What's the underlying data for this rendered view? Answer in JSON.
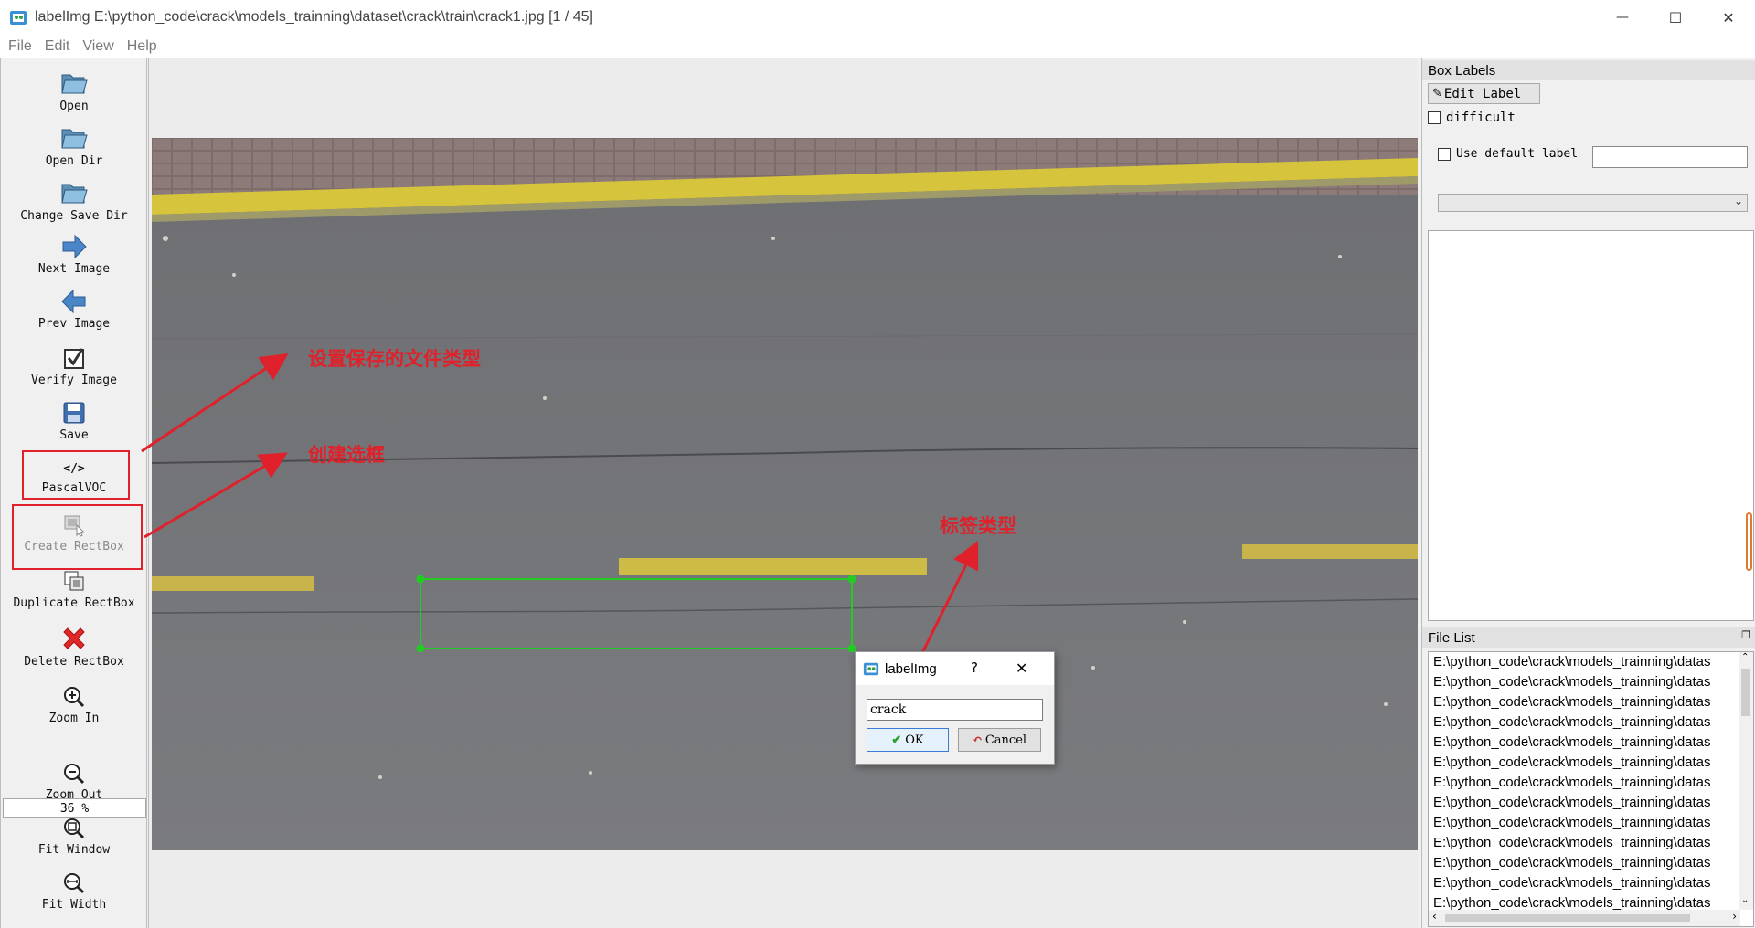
{
  "window": {
    "title": "labelImg E:\\python_code\\crack\\models_trainning\\dataset\\crack\\train\\crack1.jpg [1 / 45]",
    "minimize_symbol": "—",
    "maximize_symbol": "☐",
    "close_symbol": "✕"
  },
  "menu": [
    "File",
    "Edit",
    "View",
    "Help"
  ],
  "toolbar": {
    "open": "Open",
    "open_dir": "Open Dir",
    "change_save_dir": "Change Save Dir",
    "next_image": "Next Image",
    "prev_image": "Prev Image",
    "verify_image": "Verify Image",
    "save": "Save",
    "save_format": "PascalVOC",
    "create_rectbox": "Create RectBox",
    "duplicate_rectbox": "Duplicate RectBox",
    "delete_rectbox": "Delete RectBox",
    "zoom_in": "Zoom In",
    "zoom_value": "36 %",
    "zoom_out": "Zoom Out",
    "fit_window": "Fit Window",
    "fit_width": "Fit Width"
  },
  "annotations": {
    "save_format_note": "设置保存的文件类型",
    "create_box_note": "创建选框",
    "label_type_note": "标签类型"
  },
  "box_labels": {
    "header": "Box Labels",
    "edit_label_button": "Edit Label",
    "difficult": "difficult",
    "use_default_label": "Use default label",
    "default_label_value": ""
  },
  "file_list": {
    "header": "File List",
    "items": [
      "E:\\python_code\\crack\\models_trainning\\datas",
      "E:\\python_code\\crack\\models_trainning\\datas",
      "E:\\python_code\\crack\\models_trainning\\datas",
      "E:\\python_code\\crack\\models_trainning\\datas",
      "E:\\python_code\\crack\\models_trainning\\datas",
      "E:\\python_code\\crack\\models_trainning\\datas",
      "E:\\python_code\\crack\\models_trainning\\datas",
      "E:\\python_code\\crack\\models_trainning\\datas",
      "E:\\python_code\\crack\\models_trainning\\datas",
      "E:\\python_code\\crack\\models_trainning\\datas",
      "E:\\python_code\\crack\\models_trainning\\datas",
      "E:\\python_code\\crack\\models_trainning\\datas",
      "E:\\python_code\\crack\\models_trainning\\datas"
    ]
  },
  "dialog": {
    "title": "labelImg",
    "help_symbol": "?",
    "close_symbol": "✕",
    "input_value": "crack",
    "ok_label": "OK",
    "cancel_label": "Cancel"
  },
  "colors": {
    "annotation_red": "#e0202a",
    "bbox_green": "#22cc22",
    "lane_yellow": "#d9c94a"
  }
}
